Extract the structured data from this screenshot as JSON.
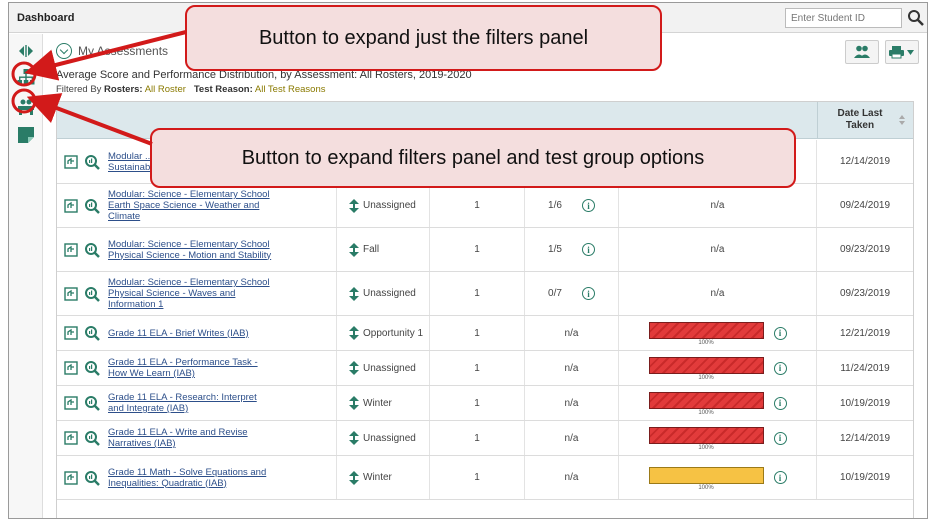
{
  "app": {
    "title": "Dashboard",
    "student_input_placeholder": "Enter Student ID"
  },
  "section": {
    "title": "My Assessments",
    "subtitle": "Average Score and Performance Distribution, by Assessment: All Rosters, 2019-2020",
    "filter_prefix": "Filtered By",
    "rosters_label": "Rosters:",
    "rosters_value": "All Roster",
    "reason_label": "Test Reason:",
    "reason_value": "All Test Reasons"
  },
  "table": {
    "date_header": "Date Last Taken",
    "rows": [
      {
        "name": "Modular Science - Elementary School Earth Space Science - Human Sustainability 2",
        "name_visible": "Modular ... Space Science - Human Sustainability 2",
        "reason": "",
        "count": "",
        "score": "",
        "perf": "",
        "date": "12/14/2019"
      },
      {
        "name": "Modular: Science - Elementary School Earth Space Science - Weather and Climate",
        "reason": "Unassigned",
        "count": "1",
        "score": "1/6",
        "perf": "n/a",
        "date": "09/24/2019"
      },
      {
        "name": "Modular: Science - Elementary School Physical Science - Motion and Stability",
        "reason": "Fall",
        "count": "1",
        "score": "1/5",
        "perf": "n/a",
        "date": "09/23/2019"
      },
      {
        "name": "Modular: Science - Elementary School Physical Science - Waves and Information 1",
        "reason": "Unassigned",
        "count": "1",
        "score": "0/7",
        "perf": "n/a",
        "date": "09/23/2019"
      },
      {
        "name": "Grade 11 ELA - Brief Writes (IAB)",
        "reason": "Opportunity 1",
        "count": "1",
        "score": "n/a",
        "perf": "100%",
        "date": "12/21/2019"
      },
      {
        "name": "Grade 11 ELA - Performance Task - How We Learn (IAB)",
        "reason": "Unassigned",
        "count": "1",
        "score": "n/a",
        "perf": "100%",
        "date": "11/24/2019"
      },
      {
        "name": "Grade 11 ELA - Research: Interpret and Integrate (IAB)",
        "reason": "Winter",
        "count": "1",
        "score": "n/a",
        "perf": "100%",
        "date": "10/19/2019"
      },
      {
        "name": "Grade 11 ELA - Write and Revise Narratives (IAB)",
        "reason": "Unassigned",
        "count": "1",
        "score": "n/a",
        "perf": "100%",
        "date": "12/14/2019"
      },
      {
        "name": "Grade 11 Math - Solve Equations and Inequalities: Quadratic (IAB)",
        "reason": "Winter",
        "count": "1",
        "score": "n/a",
        "perf": "100%",
        "date": "10/19/2019"
      }
    ]
  },
  "callouts": {
    "filters": "Button to expand just the filters panel",
    "filters_groups": "Button to expand filters panel and test group options"
  },
  "colors": {
    "accent": "#2a7c67",
    "callout_border": "#d21a1a",
    "callout_fill": "#f4dede",
    "bar_red": "#e23b3b",
    "bar_yellow": "#f6c244"
  }
}
